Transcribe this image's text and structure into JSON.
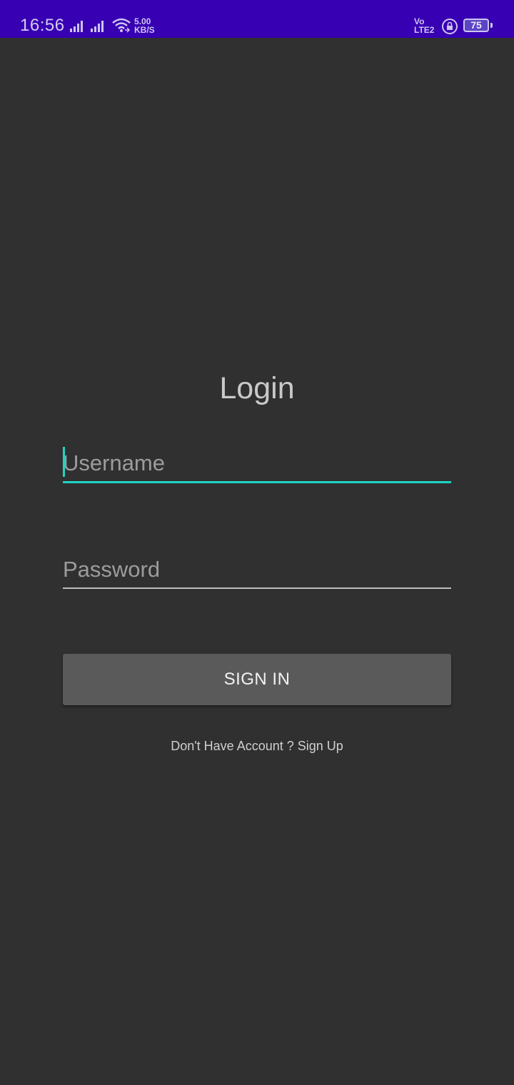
{
  "status_bar": {
    "time": "16:56",
    "net_speed_value": "5.00",
    "net_speed_unit": "KB/S",
    "volte_line1": "Vo",
    "volte_line2": "LTE2",
    "battery_level": "75",
    "icons": [
      "signal-icon",
      "signal-icon",
      "wifi-icon",
      "lock-icon",
      "battery-icon"
    ],
    "background_color": "#3700b3"
  },
  "login": {
    "title": "Login",
    "username_placeholder": "Username",
    "username_value": "",
    "password_placeholder": "Password",
    "password_value": "",
    "signin_label": "SIGN IN",
    "signup_text": "Don't Have Account ? Sign Up"
  },
  "colors": {
    "background": "#303030",
    "accent": "#1fd4c4",
    "button": "#5a5a5a"
  }
}
